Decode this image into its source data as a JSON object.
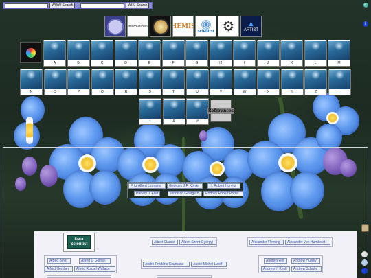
{
  "search": {
    "www_button": "WWW Search",
    "wiki_button": "WIKI Search",
    "www_placeholder": "",
    "wiki_placeholder": ""
  },
  "info_label": "i",
  "logos": [
    {
      "name": "seal-logo",
      "text": ""
    },
    {
      "name": "informatician-logo",
      "text": "Informatician"
    },
    {
      "name": "medal-logo",
      "text": ""
    },
    {
      "name": "chemist-logo",
      "text": "CHEMIST"
    },
    {
      "name": "scientist-logo",
      "text": "scientist"
    },
    {
      "name": "gear-logo",
      "text": ""
    },
    {
      "name": "artist-logo",
      "text": "ARTIST"
    }
  ],
  "tiles_row1": [
    "A",
    "B",
    "C",
    "D",
    "E",
    "F",
    "G",
    "H",
    "I",
    "J",
    "K",
    "L",
    "M"
  ],
  "tiles_row2": [
    "N",
    "O",
    "P",
    "Q",
    "R",
    "S",
    "T",
    "U",
    "V",
    "W",
    "X",
    "Y",
    "Z",
    "_"
  ],
  "tiles_row3": [
    "~",
    "&",
    "#"
  ],
  "references_label": "References",
  "names_panel": {
    "row1": [
      "Fritz Albert Lipmann",
      "Georges J.F. Köhler",
      "H. Robert Horvitz"
    ],
    "row2": [
      "Harvey J. Alter",
      "Jennison George B",
      "Rodney Robert Porter"
    ]
  },
  "lower": {
    "data_scientist": "Data\nScientist",
    "groups": [
      {
        "names": [
          "Albert Claude",
          "Albert Szent-Györgyi"
        ]
      },
      {
        "names": [
          "Alexander Fleming",
          "Alexander Von Humboldt"
        ]
      },
      {
        "names": [
          "Alfred Binet",
          "Alfred G Gilman",
          "Alfred Hershey",
          "Alfred Russel Wallace"
        ]
      },
      {
        "names": [
          "André Frédéric Cournand",
          "André Michel Lwoff"
        ]
      },
      {
        "names": [
          "Andrew Fire",
          "Andrew Huxley",
          "Andrew H Knoll",
          "Andrew Schally"
        ]
      }
    ]
  }
}
